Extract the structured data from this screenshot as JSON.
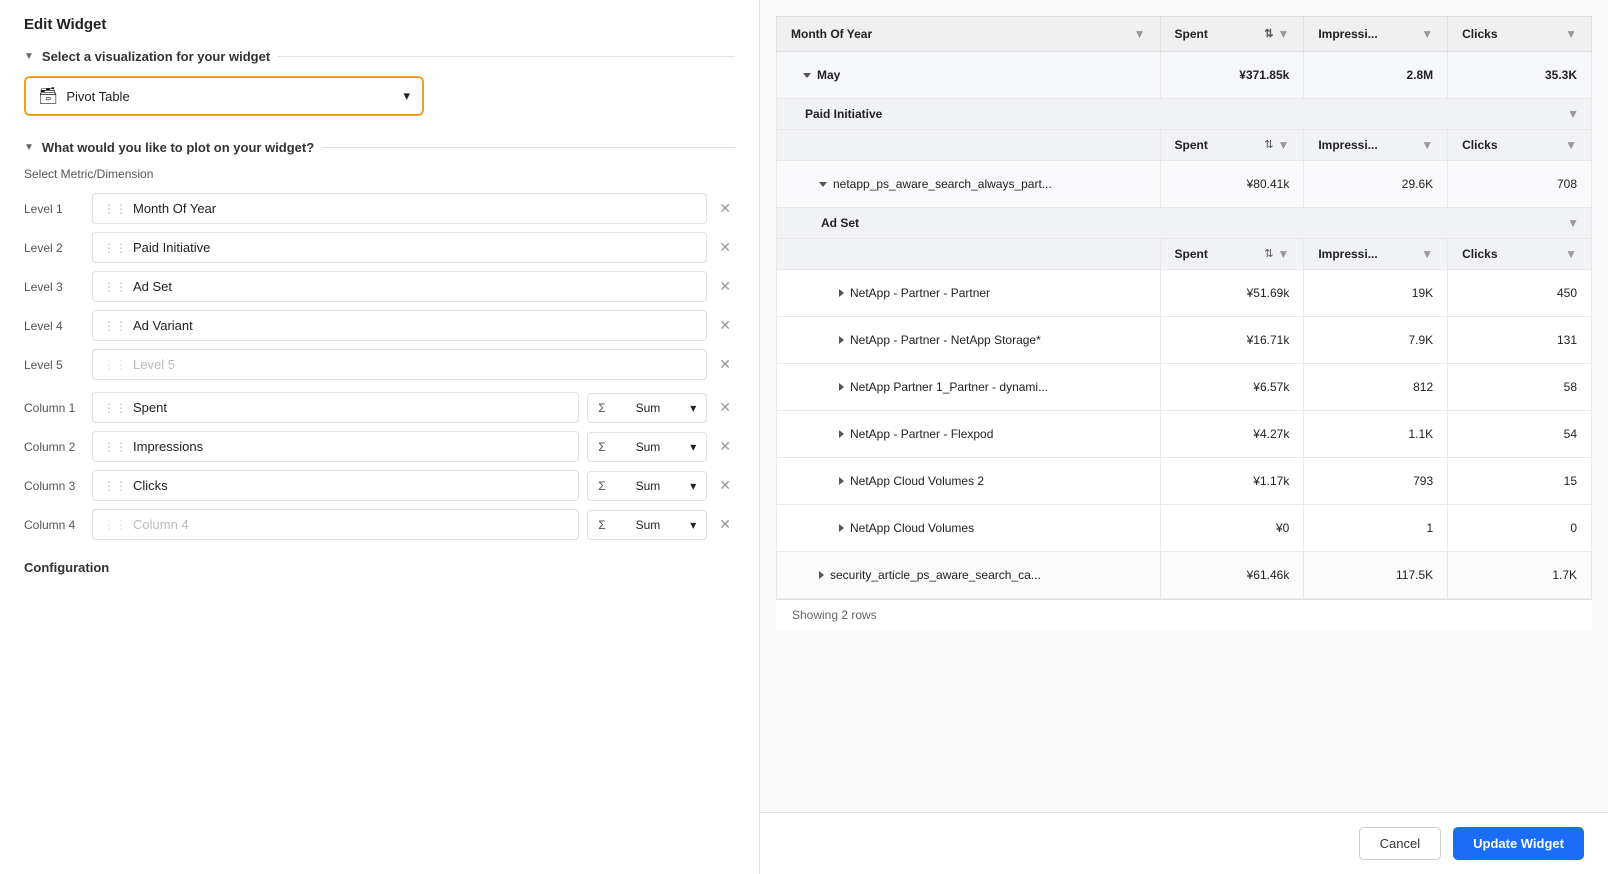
{
  "page": {
    "title": "Edit Widget"
  },
  "left": {
    "viz_section_label": "Select a visualization for your widget",
    "viz_selected": "Pivot Table",
    "viz_icon": "⊞",
    "plot_section_label": "What would you like to plot on your widget?",
    "plot_subtitle": "Select Metric/Dimension",
    "levels": [
      {
        "label": "Level 1",
        "value": "Month Of Year",
        "placeholder": false
      },
      {
        "label": "Level 2",
        "value": "Paid Initiative",
        "placeholder": false
      },
      {
        "label": "Level 3",
        "value": "Ad Set",
        "placeholder": false
      },
      {
        "label": "Level 4",
        "value": "Ad Variant",
        "placeholder": false
      },
      {
        "label": "Level 5",
        "value": "Level 5",
        "placeholder": true
      }
    ],
    "columns": [
      {
        "label": "Column 1",
        "value": "Spent",
        "placeholder": false,
        "agg": "Σ Sum"
      },
      {
        "label": "Column 2",
        "value": "Impressions",
        "placeholder": false,
        "agg": "Σ Sum"
      },
      {
        "label": "Column 3",
        "value": "Clicks",
        "placeholder": false,
        "agg": "Σ Sum"
      },
      {
        "label": "Column 4",
        "value": "Column 4",
        "placeholder": true,
        "agg": "Σ Sum"
      }
    ],
    "config_label": "Configuration"
  },
  "right": {
    "table": {
      "col_headers": [
        {
          "label": "Month Of Year",
          "has_sort": true,
          "has_filter": true
        },
        {
          "label": "Spent",
          "has_sort": true,
          "has_filter": true
        },
        {
          "label": "Impressi...",
          "has_sort": false,
          "has_filter": true
        },
        {
          "label": "Clicks",
          "has_sort": false,
          "has_filter": true
        }
      ],
      "rows": [
        {
          "type": "group",
          "label": "May",
          "expand": "down",
          "spent": "¥371.85k",
          "impressions": "2.8M",
          "clicks": "35.3K"
        },
        {
          "type": "subgroup_header",
          "label": "Paid Initiative",
          "has_filter": true
        },
        {
          "type": "subgroup_col_header",
          "labels": [
            "Spent",
            "Impressi...",
            "Clicks"
          ]
        },
        {
          "type": "subgroup_row",
          "label": "netapp_ps_aware_search_always_part...",
          "expand": "down",
          "spent": "¥80.41k",
          "impressions": "29.6K",
          "clicks": "708"
        },
        {
          "type": "adset_header",
          "label": "Ad Set",
          "has_filter": true
        },
        {
          "type": "adset_col_header",
          "labels": [
            "Spent",
            "Impressi...",
            "Clicks"
          ]
        },
        {
          "type": "data_row",
          "label": "NetApp - Partner - Partner",
          "indent": 3,
          "spent": "¥51.69k",
          "impressions": "19K",
          "clicks": "450"
        },
        {
          "type": "data_row",
          "label": "NetApp - Partner - NetApp Storage*",
          "indent": 3,
          "spent": "¥16.71k",
          "impressions": "7.9K",
          "clicks": "131"
        },
        {
          "type": "data_row",
          "label": "NetApp Partner 1_Partner - dynami...",
          "indent": 3,
          "spent": "¥6.57k",
          "impressions": "812",
          "clicks": "58"
        },
        {
          "type": "data_row",
          "label": "NetApp - Partner - Flexpod",
          "indent": 3,
          "spent": "¥4.27k",
          "impressions": "1.1K",
          "clicks": "54"
        },
        {
          "type": "data_row",
          "label": "NetApp Cloud Volumes 2",
          "indent": 3,
          "spent": "¥1.17k",
          "impressions": "793",
          "clicks": "15"
        },
        {
          "type": "data_row",
          "label": "NetApp Cloud Volumes",
          "indent": 3,
          "spent": "¥0",
          "impressions": "1",
          "clicks": "0"
        },
        {
          "type": "summary_row",
          "label": "security_article_ps_aware_search_ca...",
          "expand": "right",
          "spent": "¥61.46k",
          "impressions": "117.5K",
          "clicks": "1.7K"
        }
      ],
      "showing_rows": "Showing 2 rows"
    }
  },
  "footer": {
    "cancel_label": "Cancel",
    "update_label": "Update Widget"
  }
}
